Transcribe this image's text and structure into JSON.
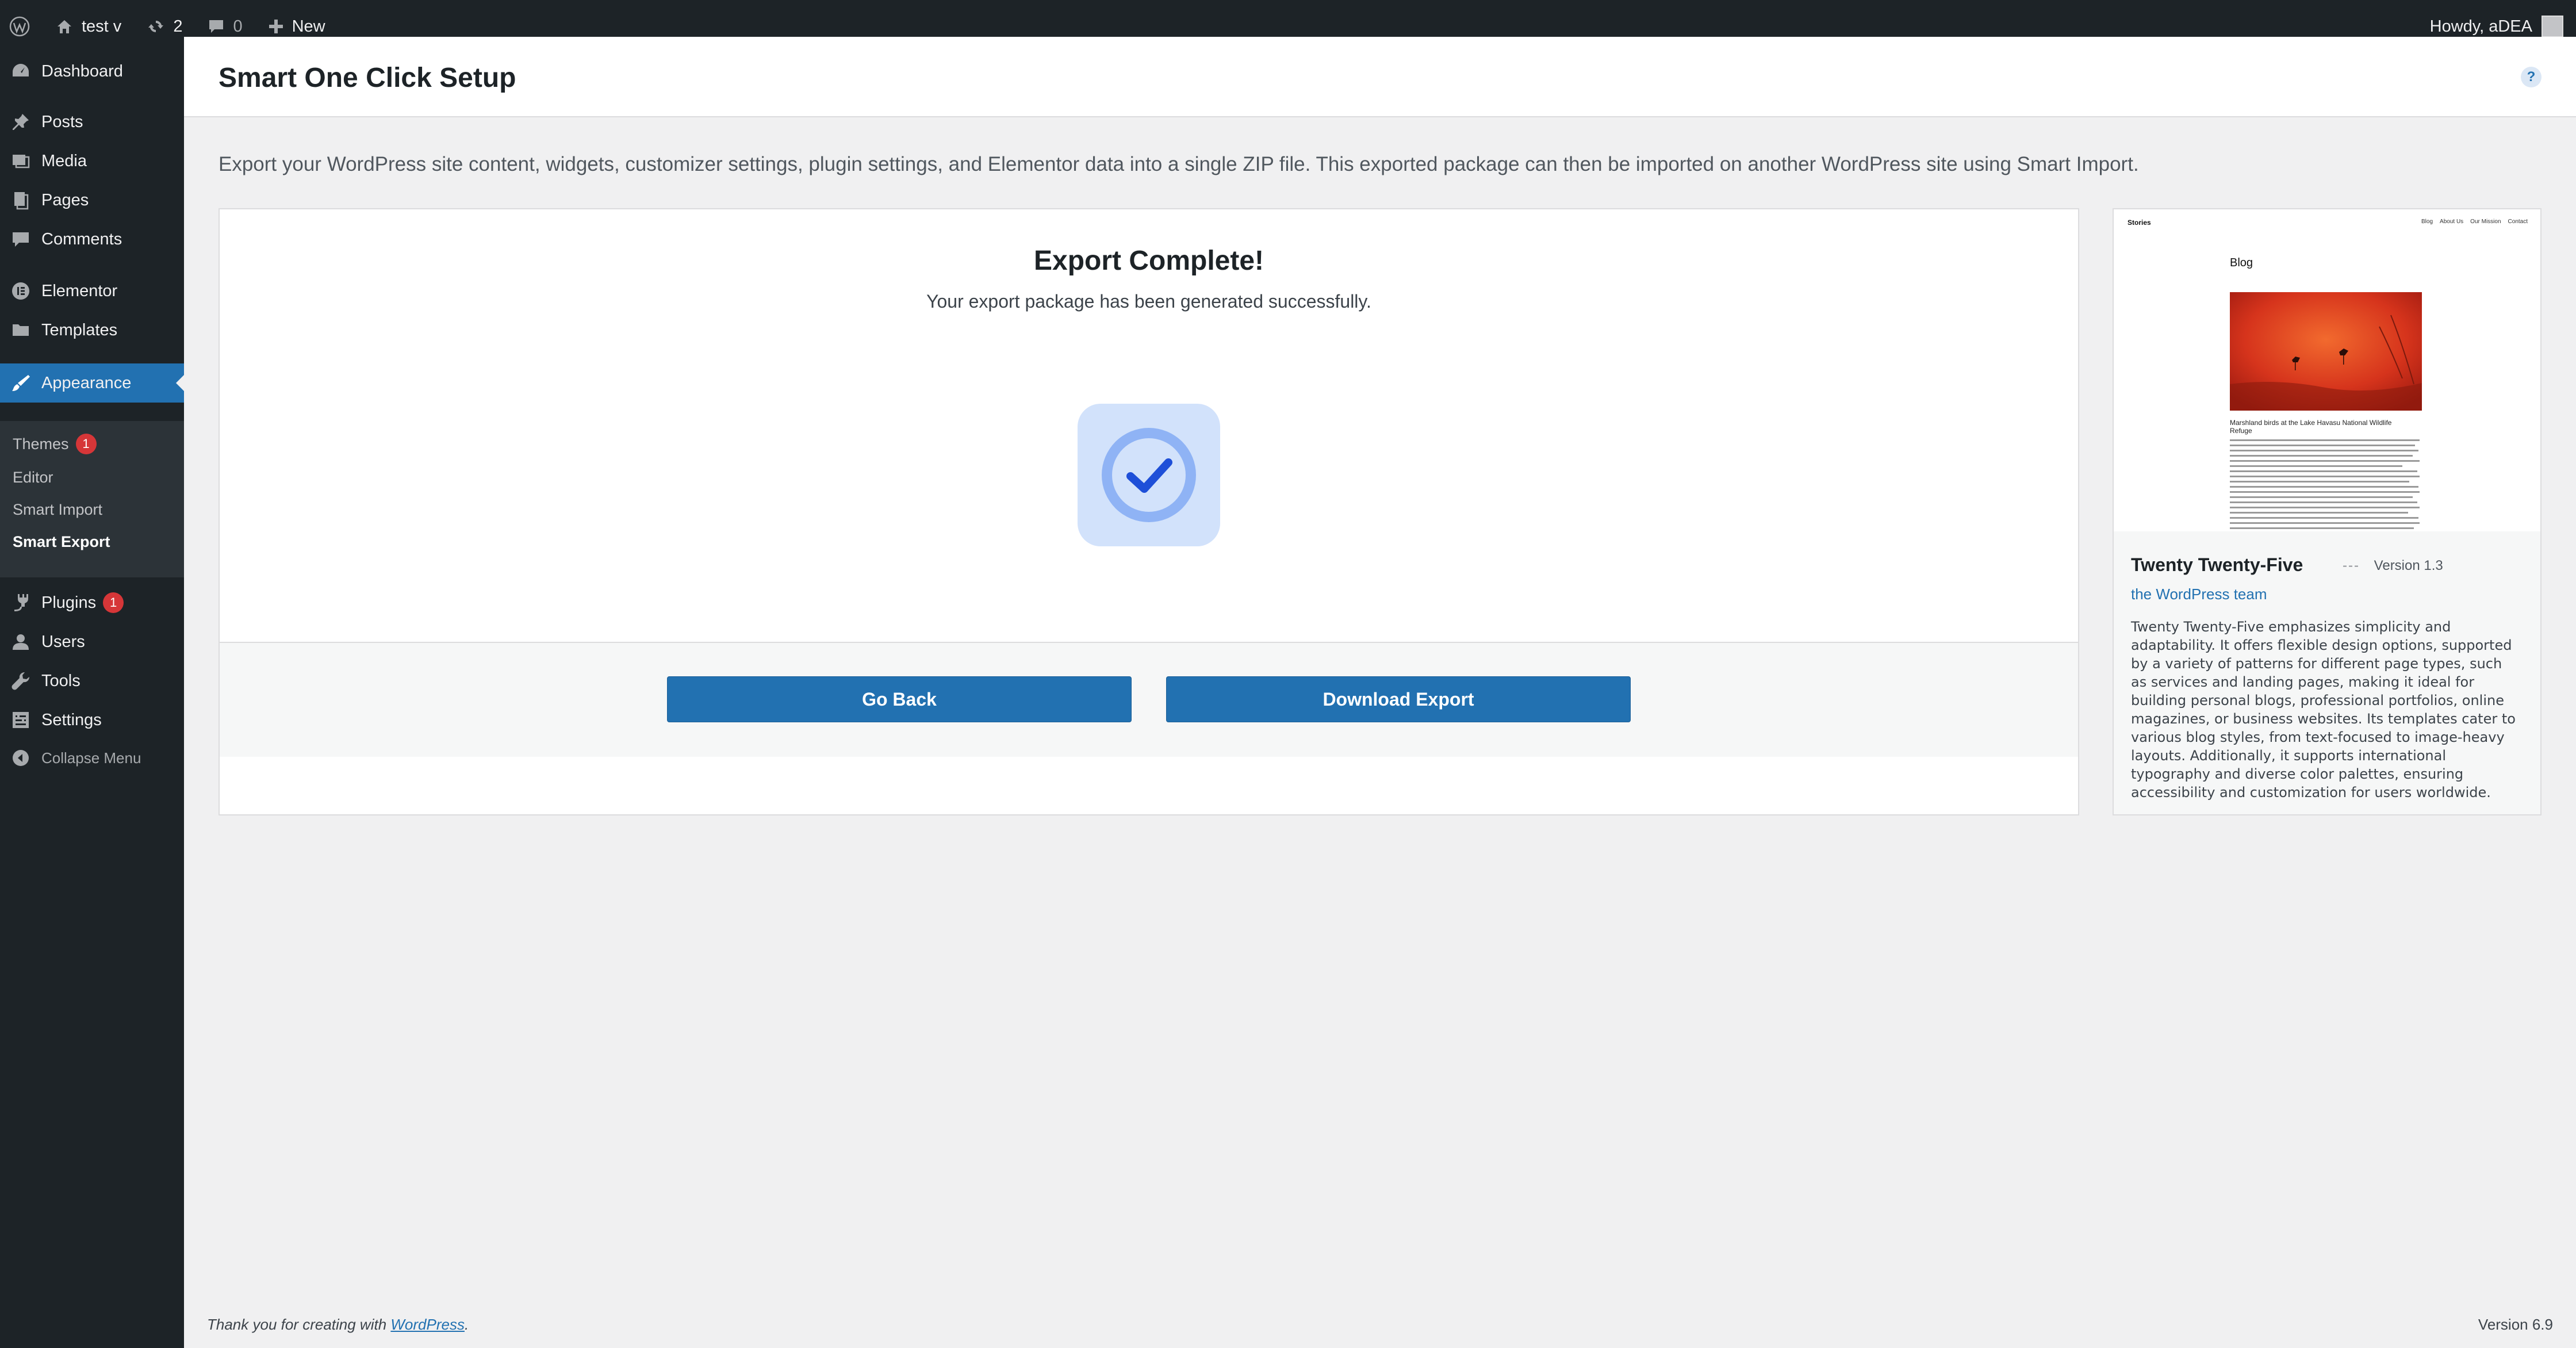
{
  "adminbar": {
    "site_name": "test v",
    "updates_count": "2",
    "comments_count": "0",
    "new_label": "New",
    "howdy": "Howdy, aDEA"
  },
  "sidebar": {
    "dashboard": "Dashboard",
    "posts": "Posts",
    "media": "Media",
    "pages": "Pages",
    "comments": "Comments",
    "elementor": "Elementor",
    "templates": "Templates",
    "appearance": "Appearance",
    "submenu": {
      "themes": "Themes",
      "themes_badge": "1",
      "editor": "Editor",
      "smart_import": "Smart Import",
      "smart_export": "Smart Export"
    },
    "plugins": "Plugins",
    "plugins_badge": "1",
    "users": "Users",
    "tools": "Tools",
    "settings": "Settings",
    "collapse": "Collapse Menu"
  },
  "header": {
    "title": "Smart One Click Setup",
    "help": "?"
  },
  "intro_text": "Export your WordPress site content, widgets, customizer settings, plugin settings, and Elementor data into a single ZIP file. This exported package can then be imported on another WordPress site using Smart Import.",
  "export": {
    "title": "Export Complete!",
    "subtitle": "Your export package has been generated successfully.",
    "go_back": "Go Back",
    "download": "Download Export"
  },
  "theme": {
    "name": "Twenty Twenty-Five",
    "separator": "---",
    "version": "Version 1.3",
    "author": "the WordPress team",
    "description": "Twenty Twenty-Five emphasizes simplicity and adaptability. It offers flexible design options, supported by a variety of patterns for different page types, such as services and landing pages, making it ideal for building personal blogs, professional portfolios, online magazines, or business websites. Its templates cater to various blog styles, from text-focused to image-heavy layouts. Additionally, it supports international typography and diverse color palettes, ensuring accessibility and customization for users worldwide.",
    "screenshot": {
      "site_title": "Stories",
      "nav": [
        "Blog",
        "About Us",
        "Our Mission",
        "Contact"
      ],
      "heading": "Blog",
      "caption": "Marshland birds at the Lake Havasu National Wildlife Refuge"
    }
  },
  "footer": {
    "thanks_prefix": "Thank you for creating with ",
    "thanks_link": "WordPress",
    "thanks_suffix": ".",
    "version": "Version 6.9"
  },
  "colors": {
    "admin_dark": "#1d2327",
    "primary": "#2271b1",
    "badge": "#d63638",
    "success_bg": "#d2e2fb",
    "success_icon": "#1e4fd8"
  }
}
